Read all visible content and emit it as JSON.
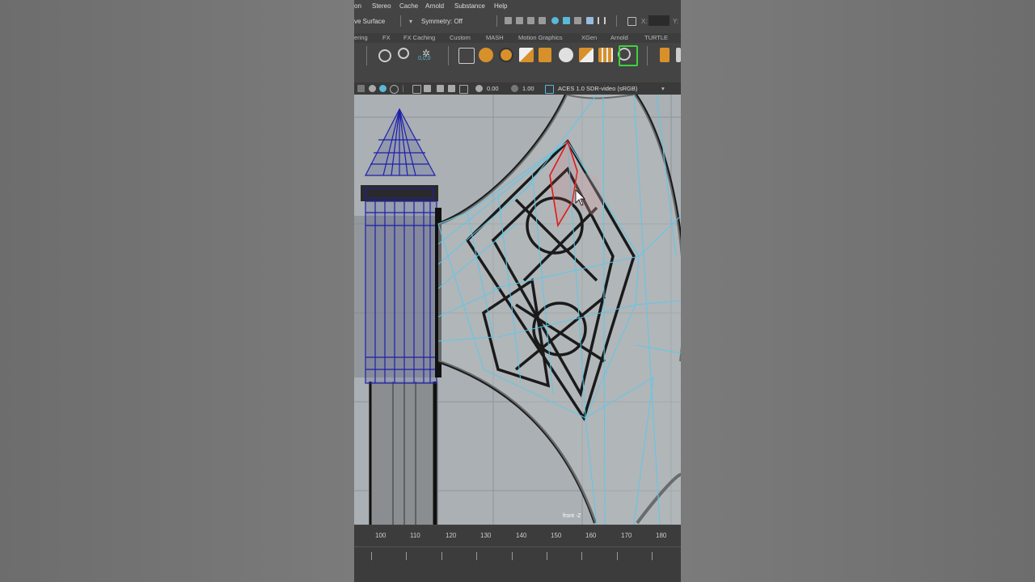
{
  "menu": [
    "on",
    "Stereo",
    "Cache",
    "Arnold",
    "Substance",
    "Help"
  ],
  "status": {
    "live_surface": "ve Surface",
    "symmetry": "Symmetry: Off",
    "x_label": "X:",
    "y_label": "Y:"
  },
  "shelf_tabs": [
    "ering",
    "FX",
    "FX Caching",
    "Custom",
    "MASH",
    "Motion Graphics",
    "XGen",
    "Arnold",
    "TURTLE"
  ],
  "shelf_small_label": "0,0,0",
  "viewport_bar": {
    "exposure": "0.00",
    "gamma": "1.00",
    "colorspace": "ACES 1.0 SDR-video (sRGB)"
  },
  "viewport": {
    "camera_label": "front -Z"
  },
  "timeline": {
    "ticks": [
      "100",
      "110",
      "120",
      "130",
      "140",
      "150",
      "160",
      "170",
      "180"
    ]
  },
  "colors": {
    "wire_blue": "#1f1fa8",
    "wire_cyan": "#5ec8e8",
    "selected_face": "#e01818",
    "sketch_line": "#1a1a1a"
  }
}
